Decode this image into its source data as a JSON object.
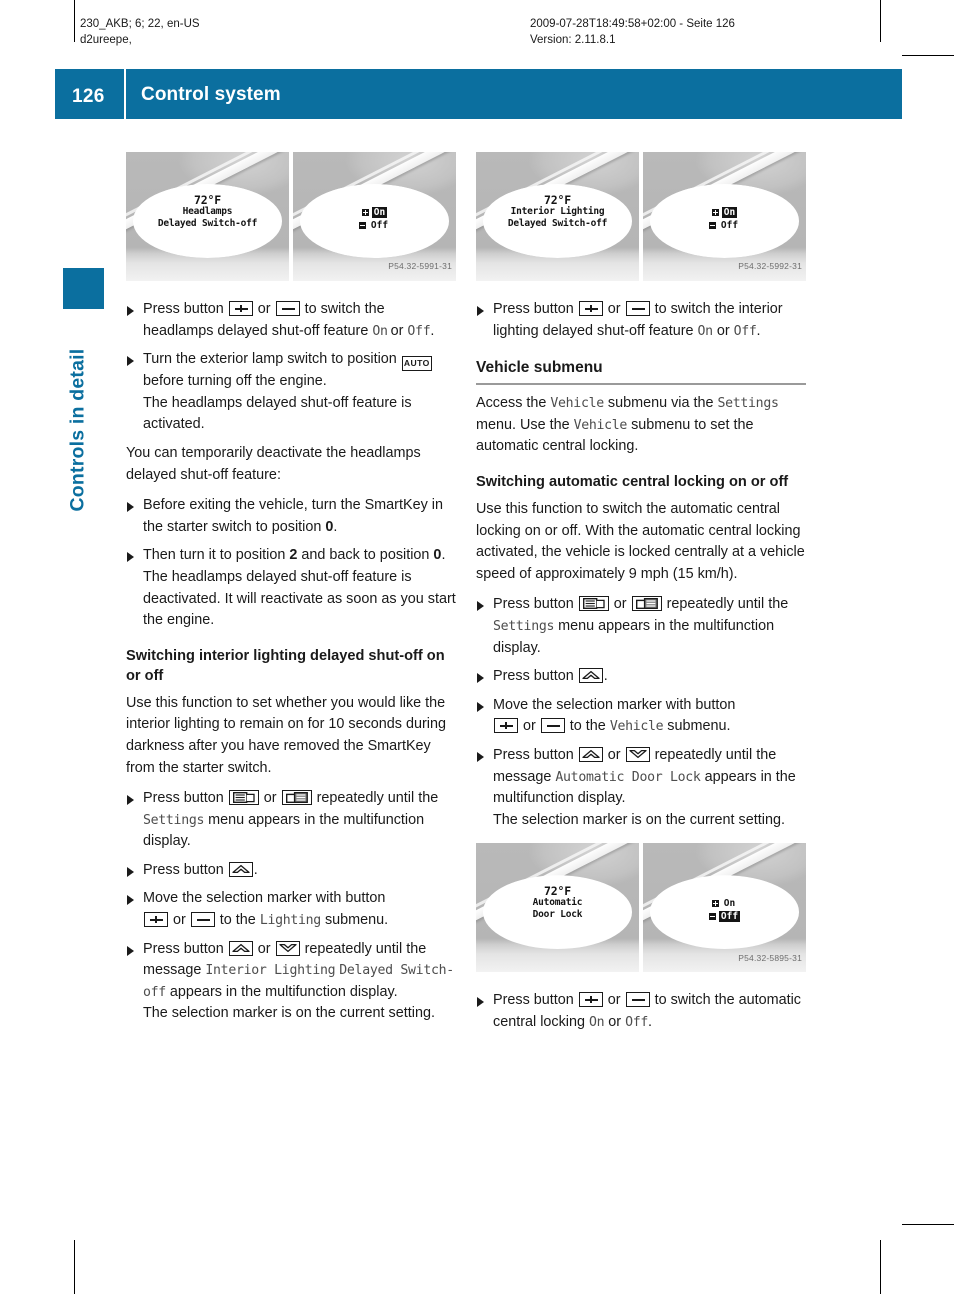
{
  "production_header": {
    "left_line1": "230_AKB; 6; 22, en-US",
    "left_line2": "d2ureepe,",
    "right_line1": "2009-07-28T18:49:58+02:00 - Seite 126",
    "right_line2": "Version: 2.11.8.1"
  },
  "banner": {
    "page_number": "126",
    "chapter_title": "Control system",
    "accent_color": "#0b6f9f"
  },
  "thumb_tab": {
    "label": "Controls in detail",
    "color": "#0b6f9f"
  },
  "figures": {
    "headlamps": {
      "code": "P54.32-5991-31",
      "left_panel": {
        "temperature": "72°F",
        "line1": "Headlamps",
        "line2": "Delayed Switch-off"
      },
      "right_panel": {
        "option_on": "On",
        "option_off": "Off",
        "selected": "On"
      }
    },
    "interior_lighting": {
      "code": "P54.32-5992-31",
      "left_panel": {
        "temperature": "72°F",
        "line1": "Interior Lighting",
        "line2": "Delayed Switch-off"
      },
      "right_panel": {
        "option_on": "On",
        "option_off": "Off",
        "selected": "On"
      }
    },
    "automatic_door_lock": {
      "code": "P54.32-5895-31",
      "left_panel": {
        "temperature": "72°F",
        "line1": "Automatic",
        "line2": "Door Lock"
      },
      "right_panel": {
        "option_on": "On",
        "option_off": "Off",
        "selected": "Off"
      }
    }
  },
  "left_column": {
    "step_headlamp_switch_1": "Press button",
    "step_headlamp_switch_or": "or",
    "step_headlamp_switch_2": "to switch the headlamps delayed shut-off feature",
    "step_headlamp_switch_on": "On",
    "step_headlamp_switch_mid": "or",
    "step_headlamp_switch_off": "Off",
    "step_headlamp_switch_end": ".",
    "step_auto_1": "Turn the exterior lamp switch to position",
    "step_auto_key": "AUTO",
    "step_auto_2": "before turning off the engine.",
    "step_auto_result": "The headlamps delayed shut-off feature is activated.",
    "para_temporarily": "You can temporarily deactivate the headlamps delayed shut-off feature:",
    "step_before_exiting_1": "Before exiting the vehicle, turn the SmartKey in the starter switch to position",
    "step_before_exiting_pos": "0",
    "step_before_exiting_2": ".",
    "step_then_turn_1": "Then turn it to position",
    "step_then_turn_pos1": "2",
    "step_then_turn_2": "and back to position",
    "step_then_turn_pos2": "0",
    "step_then_turn_3": ".",
    "step_then_turn_result": "The headlamps delayed shut-off feature is deactivated. It will reactivate as soon as you start the engine.",
    "heading_interior": "Switching interior lighting delayed shut-off on or off",
    "para_interior_use": "Use this function to set whether you would like the interior lighting to remain on for 10 seconds during darkness after you have removed the SmartKey from the starter switch.",
    "step_settings_1": "Press button",
    "step_settings_or": "or",
    "step_settings_2": "repeatedly until the",
    "step_settings_menu": "Settings",
    "step_settings_3": "menu appears in the multifunction display.",
    "step_press_up": "Press button",
    "step_press_up_end": ".",
    "step_move_marker_1": "Move the selection marker with button",
    "step_move_marker_or": "or",
    "step_move_marker_2": "to the",
    "step_move_marker_menu": "Lighting",
    "step_move_marker_3": "submenu.",
    "step_until_msg_1": "Press button",
    "step_until_msg_or": "or",
    "step_until_msg_2": "repeatedly until the message",
    "step_until_msg_display_1": "Interior Lighting",
    "step_until_msg_display_2": "Delayed Switch-off",
    "step_until_msg_3": "appears in the multifunction display.",
    "step_until_msg_result": "The selection marker is on the current setting."
  },
  "right_column": {
    "step_interior_switch_1": "Press button",
    "step_interior_switch_or": "or",
    "step_interior_switch_2": "to switch the interior lighting delayed shut-off feature",
    "step_interior_switch_on": "On",
    "step_interior_switch_mid": "or",
    "step_interior_switch_off": "Off",
    "step_interior_switch_end": ".",
    "heading_vehicle_submenu": "Vehicle submenu",
    "para_access_1": "Access the",
    "para_access_vehicle_1": "Vehicle",
    "para_access_2": "submenu via the",
    "para_access_settings": "Settings",
    "para_access_3": "menu. Use the",
    "para_access_vehicle_2": "Vehicle",
    "para_access_4": "submenu to set the automatic central locking.",
    "heading_central_locking": "Switching automatic central locking on or off",
    "para_central_locking_use": "Use this function to switch the automatic central locking on or off. With the automatic central locking activated, the vehicle is locked centrally at a vehicle speed of approximately 9 mph (15 km/h).",
    "step_settings_1": "Press button",
    "step_settings_or": "or",
    "step_settings_2": "repeatedly until the",
    "step_settings_menu": "Settings",
    "step_settings_3": "menu appears in the multifunction display.",
    "step_press_up": "Press button",
    "step_press_up_end": ".",
    "step_move_marker_1": "Move the selection marker with button",
    "step_move_marker_or": "or",
    "step_move_marker_2": "to the",
    "step_move_marker_menu": "Vehicle",
    "step_move_marker_3": "submenu.",
    "step_until_msg_1": "Press button",
    "step_until_msg_or": "or",
    "step_until_msg_2": "repeatedly until the message",
    "step_until_msg_display": "Automatic Door Lock",
    "step_until_msg_3": "appears in the multifunction display.",
    "step_until_msg_result": "The selection marker is on the current setting.",
    "step_final_1": "Press button",
    "step_final_or": "or",
    "step_final_2": "to switch the automatic central locking",
    "step_final_on": "On",
    "step_final_mid": "or",
    "step_final_off": "Off",
    "step_final_end": "."
  }
}
